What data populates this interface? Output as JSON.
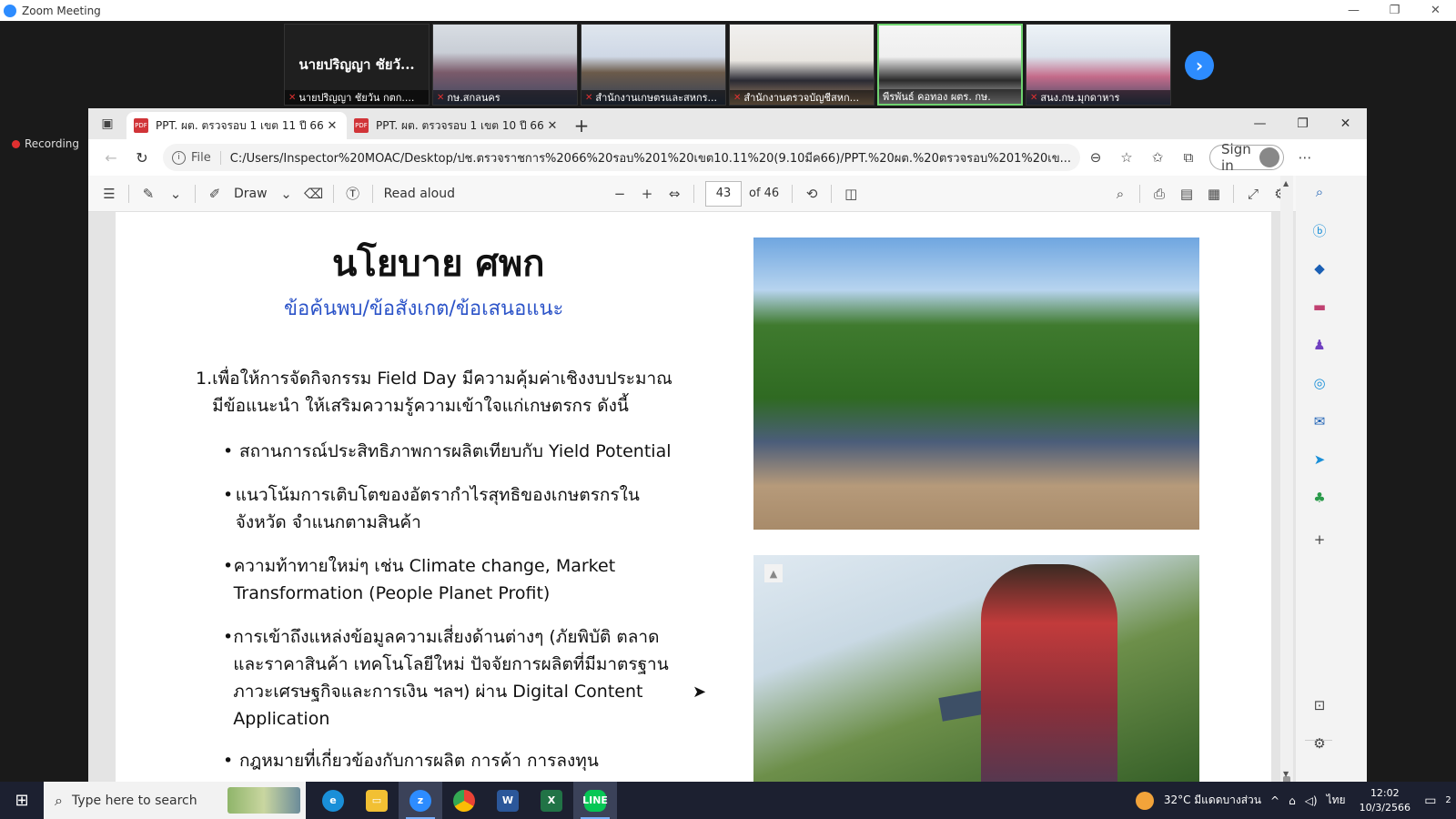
{
  "zoom": {
    "title": "Zoom Meeting",
    "recording": "Recording",
    "featured_name": "นายปริญญา ชัยวั...",
    "participants": [
      "นายปริญญา ชัยวัน กตก....",
      "กษ.สกลนคร",
      "สำนักงานเกษตรและสหกร...",
      "สำนักงานตรวจบัญชีสหก...",
      "พีรพันธ์ คอทอง ผตร. กษ.",
      "สนง.กษ.มุกดาหาร"
    ],
    "next_icon": "›"
  },
  "browser": {
    "tabs": [
      {
        "label": "PPT. ผต. ตรวจรอบ 1 เขต 11 ปี 66 (1",
        "active": true
      },
      {
        "label": "PPT. ผต. ตรวจรอบ 1 เขต 10 ปี 66 (9",
        "active": false
      }
    ],
    "file_label": "File",
    "url": "C:/Users/Inspector%20MOAC/Desktop/ปช.ตรวจราชการ%2066%20รอบ%201%20เขต10.11%20(9.10มีค66)/PPT.%20ผต.%20ตรวจรอบ%201%20เข...",
    "signin": "Sign in"
  },
  "pdf_toolbar": {
    "draw": "Draw",
    "read_aloud": "Read aloud",
    "page": "43",
    "of": "of 46"
  },
  "slide": {
    "title": "นโยบาย ศพก",
    "subtitle": "ข้อค้นพบ/ข้อสังเกต/ข้อเสนอแนะ",
    "item_number": "1.",
    "item_text": "เพื่อให้การจัดกิจกรรม Field Day มีความคุ้มค่าเชิงงบประมาณ มีข้อแนะนำ ให้เสริมความรู้ความเข้าใจแก่เกษตรกร ดังนี้",
    "bullets": [
      "สถานการณ์ประสิทธิภาพการผลิตเทียบกับ Yield Potential",
      "แนวโน้มการเติบโตของอัตรากำไรสุทธิของเกษตรกรในจังหวัด จำแนกตามสินค้า",
      "ความท้าทายใหม่ๆ เช่น Climate change, Market Transformation (People Planet Profit)",
      "การเข้าถึงแหล่งข้อมูลความเสี่ยงด้านต่างๆ (ภัยพิบัติ ตลาดและราคาสินค้า เทคโนโลยีใหม่ ปัจจัยการผลิตที่มีมาตรฐาน ภาวะเศรษฐกิจและการเงิน ฯลฯ) ผ่าน Digital Content Application",
      "กฎหมายที่เกี่ยวข้องกับการผลิต การค้า การลงทุน"
    ]
  },
  "taskbar": {
    "search_placeholder": "Type here to search",
    "weather": "32°C มีแดดบางส่วน",
    "lang": "ไทย",
    "time": "12:02",
    "date": "10/3/2566",
    "notifications": "2"
  }
}
